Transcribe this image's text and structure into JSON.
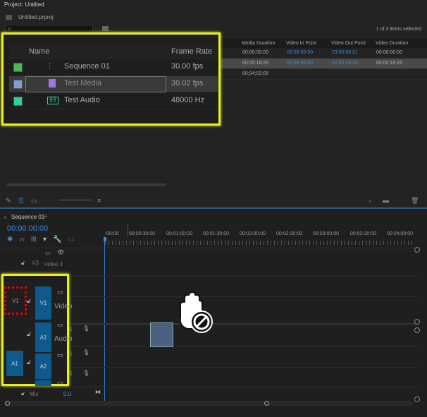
{
  "project": {
    "title": "Project: Untitled",
    "file": "Untitled.prproj",
    "selection": "1 of 3 items selected",
    "columns": [
      "Media Duration",
      "Video In Point",
      "Video Out Point",
      "Video Duration"
    ],
    "rows": [
      [
        "00:00:00:00",
        "00:00:00:00",
        "23:00:00:01",
        "00:00:00:00"
      ],
      [
        "00:00:18:26",
        "00:00:00:00",
        "00:00:18:25",
        "00:00:18:26"
      ],
      [
        "00;04;02;05",
        "",
        "",
        ""
      ]
    ]
  },
  "zoom_panel": {
    "headers": [
      "Name",
      "Frame Rate"
    ],
    "items": [
      {
        "name": "Sequence 01",
        "rate": "30.00 fps",
        "color": "#4cba52",
        "icon": "sequence-icon"
      },
      {
        "name": "Test Media",
        "rate": "30.02 fps",
        "color": "#7c9fd6",
        "icon": "media-icon"
      },
      {
        "name": "Test Audio",
        "rate": "48000 Hz",
        "color": "#2fd39a",
        "icon": "audio-icon"
      }
    ]
  },
  "timeline": {
    "tab": "Sequence 01",
    "timecode": "00:00:00:00",
    "ticks": [
      ":00:00",
      "00:00:30:00",
      "00:01:00:00",
      "00:01:30:00",
      "00:02:00:00",
      "00:02:30:00",
      "00:03:00:00",
      "00:03:30:00",
      "00:04:00:00"
    ],
    "v3": {
      "label": "V3",
      "name": "Video 3"
    },
    "v1_source": "V1",
    "v1": "V1",
    "v1_name": "Video",
    "a1": "A1",
    "a1_name": "Audio",
    "a1_source": "A1",
    "a2": "A2",
    "mix": "Mix",
    "mix_value": "0.0",
    "s": "S"
  },
  "colors": {
    "accent": "#3a8ae0",
    "highlight": "#e8f01a",
    "track": "#0e5a8e"
  }
}
